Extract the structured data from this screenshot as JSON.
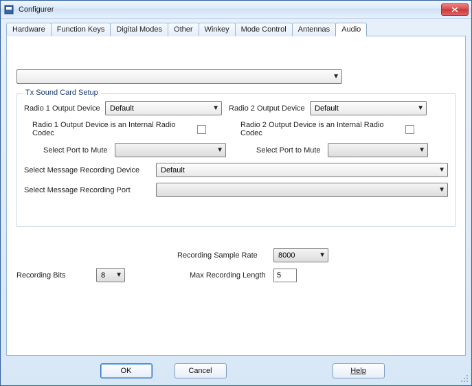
{
  "window": {
    "title": "Configurer"
  },
  "tabs": [
    {
      "label": "Hardware"
    },
    {
      "label": "Function Keys"
    },
    {
      "label": "Digital Modes"
    },
    {
      "label": "Other"
    },
    {
      "label": "Winkey"
    },
    {
      "label": "Mode Control"
    },
    {
      "label": "Antennas"
    },
    {
      "label": "Audio"
    }
  ],
  "active_tab_index": 7,
  "top_dropdown": {
    "value": ""
  },
  "group": {
    "title": "Tx Sound Card Setup",
    "radio1_output_label": "Radio 1 Output Device",
    "radio1_output_value": "Default",
    "radio2_output_label": "Radio 2 Output Device",
    "radio2_output_value": "Default",
    "radio1_codec_label": "Radio 1 Output Device is an Internal Radio Codec",
    "radio1_codec_checked": false,
    "radio2_codec_label": "Radio 2 Output Device is an Internal Radio Codec",
    "radio2_codec_checked": false,
    "port_mute_label_left": "Select Port to Mute",
    "port_mute_value_left": "",
    "port_mute_label_right": "Select Port to Mute",
    "port_mute_value_right": "",
    "msg_rec_device_label": "Select Message Recording Device",
    "msg_rec_device_value": "Default",
    "msg_rec_port_label": "Select Message Recording Port",
    "msg_rec_port_value": ""
  },
  "lower": {
    "sample_rate_label": "Recording Sample Rate",
    "sample_rate_value": "8000",
    "max_length_label": "Max Recording Length",
    "max_length_value": "5",
    "rec_bits_label": "Recording Bits",
    "rec_bits_value": "8"
  },
  "buttons": {
    "ok": "OK",
    "cancel": "Cancel",
    "help": "Help"
  }
}
